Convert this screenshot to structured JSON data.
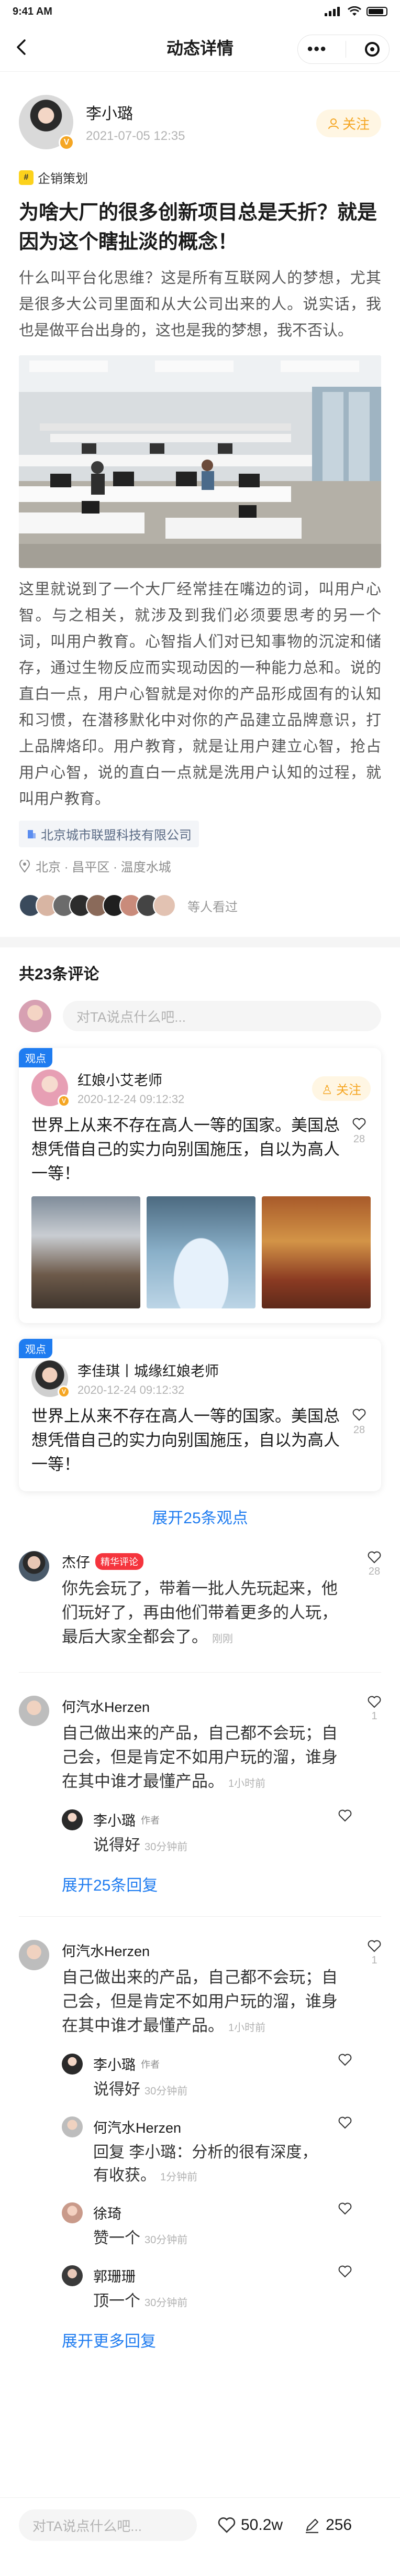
{
  "status": {
    "time": "9:41 AM"
  },
  "nav": {
    "title": "动态详情"
  },
  "post": {
    "author": "李小璐",
    "time": "2021-07-05  12:35",
    "follow_label": "关注",
    "tag": "企销策划",
    "title": "为啥大厂的很多创新项目总是夭折？就是因为这个瞎扯淡的概念！",
    "intro": "什么叫平台化思维？这是所有互联网人的梦想，尤其是很多大公司里面和从大公司出来的人。说实话，我也是做平台出身的，这也是我的梦想，我不否认。",
    "body": "这里就说到了一个大厂经常挂在嘴边的词，叫用户心智。与之相关，就涉及到我们必须要思考的另一个词，叫用户教育。心智指人们对已知事物的沉淀和储存，通过生物反应而实现动因的一种能力总和。说的直白一点，用户心智就是对你的产品形成固有的认知和习惯，在潜移默化中对你的产品建立品牌意识，打上品牌烙印。用户教育，就是让用户建立心智，抢占用户心智，说的直白一点就是洗用户认知的过程，就叫用户教育。",
    "company": "北京城市联盟科技有限公司",
    "location": "北京 · 昌平区 · 温度水城",
    "viewers_text": "等人看过"
  },
  "comments": {
    "count_label": "共23条评论",
    "input_placeholder": "对TA说点什么吧...",
    "opinion_tag": "观点",
    "opinions": [
      {
        "name": "红娘小艾老师",
        "time": "2020-12-24  09:12:32",
        "follow_label": "关注",
        "text": "世界上从来不存在高人一等的国家。美国总想凭借自己的实力向别国施压，自以为高人一等！",
        "likes": "28"
      },
      {
        "name": "李佳琪丨城缘红娘老师",
        "time": "2020-12-24  09:12:32",
        "text": "世界上从来不存在高人一等的国家。美国总想凭借自己的实力向别国施压，自以为高人一等！",
        "likes": "28"
      }
    ],
    "expand_opinions": "展开25条观点",
    "list": [
      {
        "name": "杰仔",
        "badge": "精华评论",
        "text": "你先会玩了，带着一批人先玩起来，他们玩好了，再由他们带着更多的人玩，最后大家全都会了。",
        "time": "刚刚",
        "likes": "28"
      },
      {
        "name": "何汽水Herzen",
        "text": "自己做出来的产品，自己都不会玩；自己会，但是肯定不如用户玩的溜，谁身在其中谁才最懂产品。",
        "time": "1小时前",
        "likes": "1"
      },
      {
        "name": "何汽水Herzen",
        "text": "自己做出来的产品，自己都不会玩；自己会，但是肯定不如用户玩的溜，谁身在其中谁才最懂产品。",
        "time": "1小时前",
        "likes": "1"
      }
    ],
    "reply_a": {
      "name": "李小璐",
      "author_label": "作者",
      "text": "说得好",
      "time": "30分钟前"
    },
    "expand_replies": "展开25条回复",
    "replies_b": [
      {
        "name": "李小璐",
        "author_label": "作者",
        "text": "说得好",
        "time": "30分钟前"
      },
      {
        "name": "何汽水Herzen",
        "text": "回复 李小璐：分析的很有深度，有收获。",
        "time": "1分钟前"
      },
      {
        "name": "徐琦",
        "text": "赞一个",
        "time": "30分钟前"
      },
      {
        "name": "郭珊珊",
        "text": "顶一个",
        "time": "30分钟前"
      }
    ],
    "expand_more": "展开更多回复"
  },
  "bottom": {
    "placeholder": "对TA说点什么吧...",
    "likes": "50.2w",
    "comments": "256"
  },
  "colors": {
    "accent": "#1f7cf0",
    "follow": "#f5a623",
    "red": "#f5343d"
  }
}
